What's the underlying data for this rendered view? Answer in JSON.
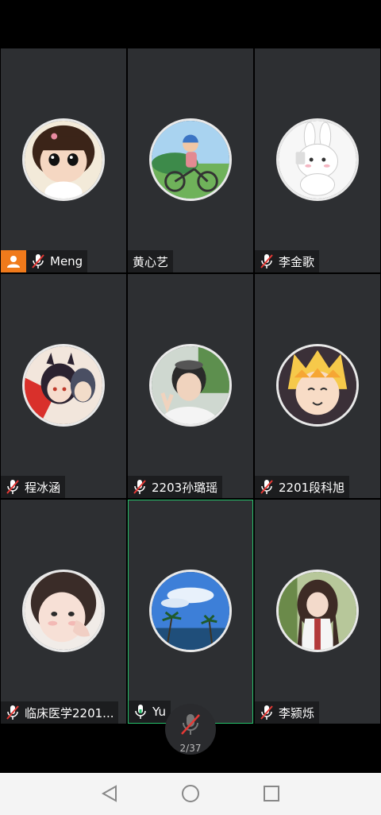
{
  "participants": [
    {
      "name": "Meng",
      "host": true,
      "muted": true,
      "active": false
    },
    {
      "name": "黄心艺",
      "host": false,
      "muted": false,
      "active": false,
      "no_mic": true
    },
    {
      "name": "李金歌",
      "host": false,
      "muted": true,
      "active": false
    },
    {
      "name": "程冰涵",
      "host": false,
      "muted": true,
      "active": false
    },
    {
      "name": "2203孙璐瑶",
      "host": false,
      "muted": true,
      "active": false
    },
    {
      "name": "2201段科旭",
      "host": false,
      "muted": true,
      "active": false
    },
    {
      "name": "临床医学2201...",
      "host": false,
      "muted": true,
      "active": false
    },
    {
      "name": "Yu",
      "host": false,
      "muted": false,
      "active": true
    },
    {
      "name": "李颍烁",
      "host": false,
      "muted": true,
      "active": false
    }
  ],
  "pager": {
    "count": "2/37"
  },
  "colors": {
    "tile_bg": "#2d2f32",
    "active_border": "#27c26c",
    "host_badge": "#f07a1b",
    "mute_red": "#e53935"
  },
  "nav": {
    "back": "back-triangle-icon",
    "home": "home-circle-icon",
    "recents": "recents-square-icon"
  }
}
